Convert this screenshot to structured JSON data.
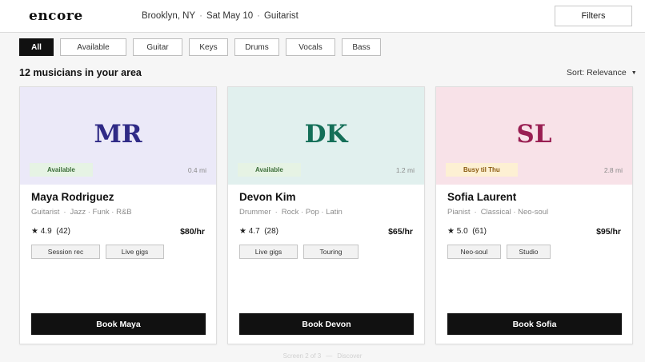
{
  "app": {
    "logo": "encore"
  },
  "context": {
    "location": "Brooklyn, NY",
    "date": "Sat May 10",
    "instrument": "Guitarist"
  },
  "header": {
    "filters_label": "Filters"
  },
  "chips": [
    {
      "label": "All",
      "active": true
    },
    {
      "label": "Available",
      "active": false
    },
    {
      "label": "Guitar",
      "active": false
    },
    {
      "label": "Keys",
      "active": false
    },
    {
      "label": "Drums",
      "active": false
    },
    {
      "label": "Vocals",
      "active": false
    },
    {
      "label": "Bass",
      "active": false
    }
  ],
  "results": {
    "count_label": "12 musicians in your area",
    "sort_label": "Sort: Relevance"
  },
  "cards": [
    {
      "initials": "MR",
      "availability": "Available",
      "distance": "0.4 mi",
      "name": "Maya Rodriguez",
      "role_line": [
        "Guitarist",
        "Jazz · Funk · R&B"
      ],
      "rating": "4.9",
      "reviews": "(42)",
      "price": "$80/hr",
      "tags": [
        "Session rec",
        "Live gigs"
      ],
      "book_label": "Book Maya",
      "colors": {
        "hero": "#ebe9f8",
        "initials": "#2f2a86",
        "badge_bg": "#e6f3e4",
        "badge_text": "#3d6e3a"
      }
    },
    {
      "initials": "DK",
      "availability": "Available",
      "distance": "1.2 mi",
      "name": "Devon Kim",
      "role_line": [
        "Drummer",
        "Rock · Pop · Latin"
      ],
      "rating": "4.7",
      "reviews": "(28)",
      "price": "$65/hr",
      "tags": [
        "Live gigs",
        "Touring"
      ],
      "book_label": "Book Devon",
      "colors": {
        "hero": "#e1f0ee",
        "initials": "#146f58",
        "badge_bg": "#e6f3e4",
        "badge_text": "#3d6e3a"
      }
    },
    {
      "initials": "SL",
      "availability": "Busy til Thu",
      "distance": "2.8 mi",
      "name": "Sofia Laurent",
      "role_line": [
        "Pianist",
        "Classical · Neo-soul"
      ],
      "rating": "5.0",
      "reviews": "(61)",
      "price": "$95/hr",
      "tags": [
        "Neo-soul",
        "Studio"
      ],
      "book_label": "Book Sofia",
      "colors": {
        "hero": "#f8e2e8",
        "initials": "#991f52",
        "badge_bg": "#fdf0d3",
        "badge_text": "#8a5a0e"
      }
    }
  ],
  "footer": {
    "screen": "Screen 2 of 3",
    "section": "Discover"
  }
}
